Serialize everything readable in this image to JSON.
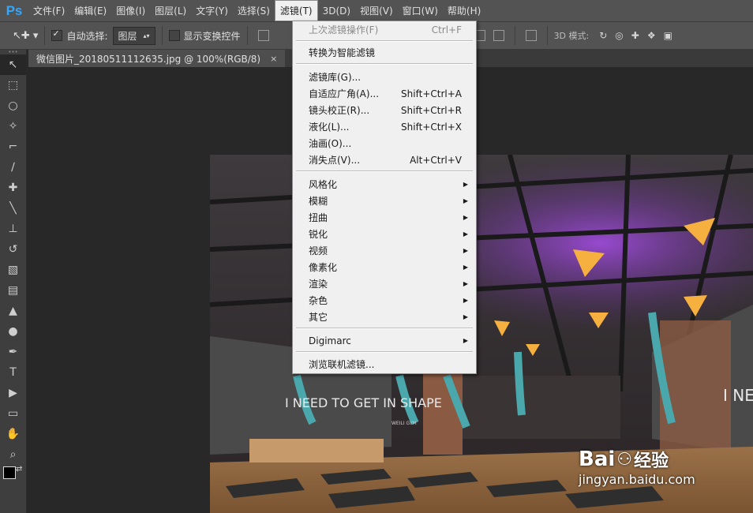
{
  "app": {
    "logo": "Ps"
  },
  "menubar": {
    "items": [
      "文件(F)",
      "编辑(E)",
      "图像(I)",
      "图层(L)",
      "文字(Y)",
      "选择(S)",
      "滤镜(T)",
      "3D(D)",
      "视图(V)",
      "窗口(W)",
      "帮助(H)"
    ],
    "active": "滤镜(T)"
  },
  "options": {
    "auto_select_label": "自动选择:",
    "auto_select_value": "图层",
    "show_transform_label": "显示变换控件",
    "mode_3d_label": "3D 模式:"
  },
  "document": {
    "tab_title": "微信图片_20180511112635.jpg @ 100%(RGB/8)",
    "close": "×"
  },
  "filter_menu": {
    "last_filter": {
      "label": "上次滤镜操作(F)",
      "shortcut": "Ctrl+F"
    },
    "convert_smart": "转换为智能滤镜",
    "items_shortcut": [
      {
        "label": "滤镜库(G)...",
        "shortcut": ""
      },
      {
        "label": "自适应广角(A)...",
        "shortcut": "Shift+Ctrl+A"
      },
      {
        "label": "镜头校正(R)...",
        "shortcut": "Shift+Ctrl+R"
      },
      {
        "label": "液化(L)...",
        "shortcut": "Shift+Ctrl+X"
      },
      {
        "label": "油画(O)...",
        "shortcut": ""
      },
      {
        "label": "消失点(V)...",
        "shortcut": "Alt+Ctrl+V"
      }
    ],
    "submenus": [
      "风格化",
      "模糊",
      "扭曲",
      "锐化",
      "视频",
      "像素化",
      "渲染",
      "杂色",
      "其它"
    ],
    "digimarc": "Digimarc",
    "browse_online": "浏览联机滤镜..."
  },
  "photo": {
    "wall_text_left": "I NEED TO GET IN SHAPE",
    "wall_text_right": "I NEED",
    "brand": "WEILI GYM"
  },
  "watermark": {
    "brand": "Bai",
    "brand2": "经验",
    "url": "jingyan.baidu.com"
  }
}
